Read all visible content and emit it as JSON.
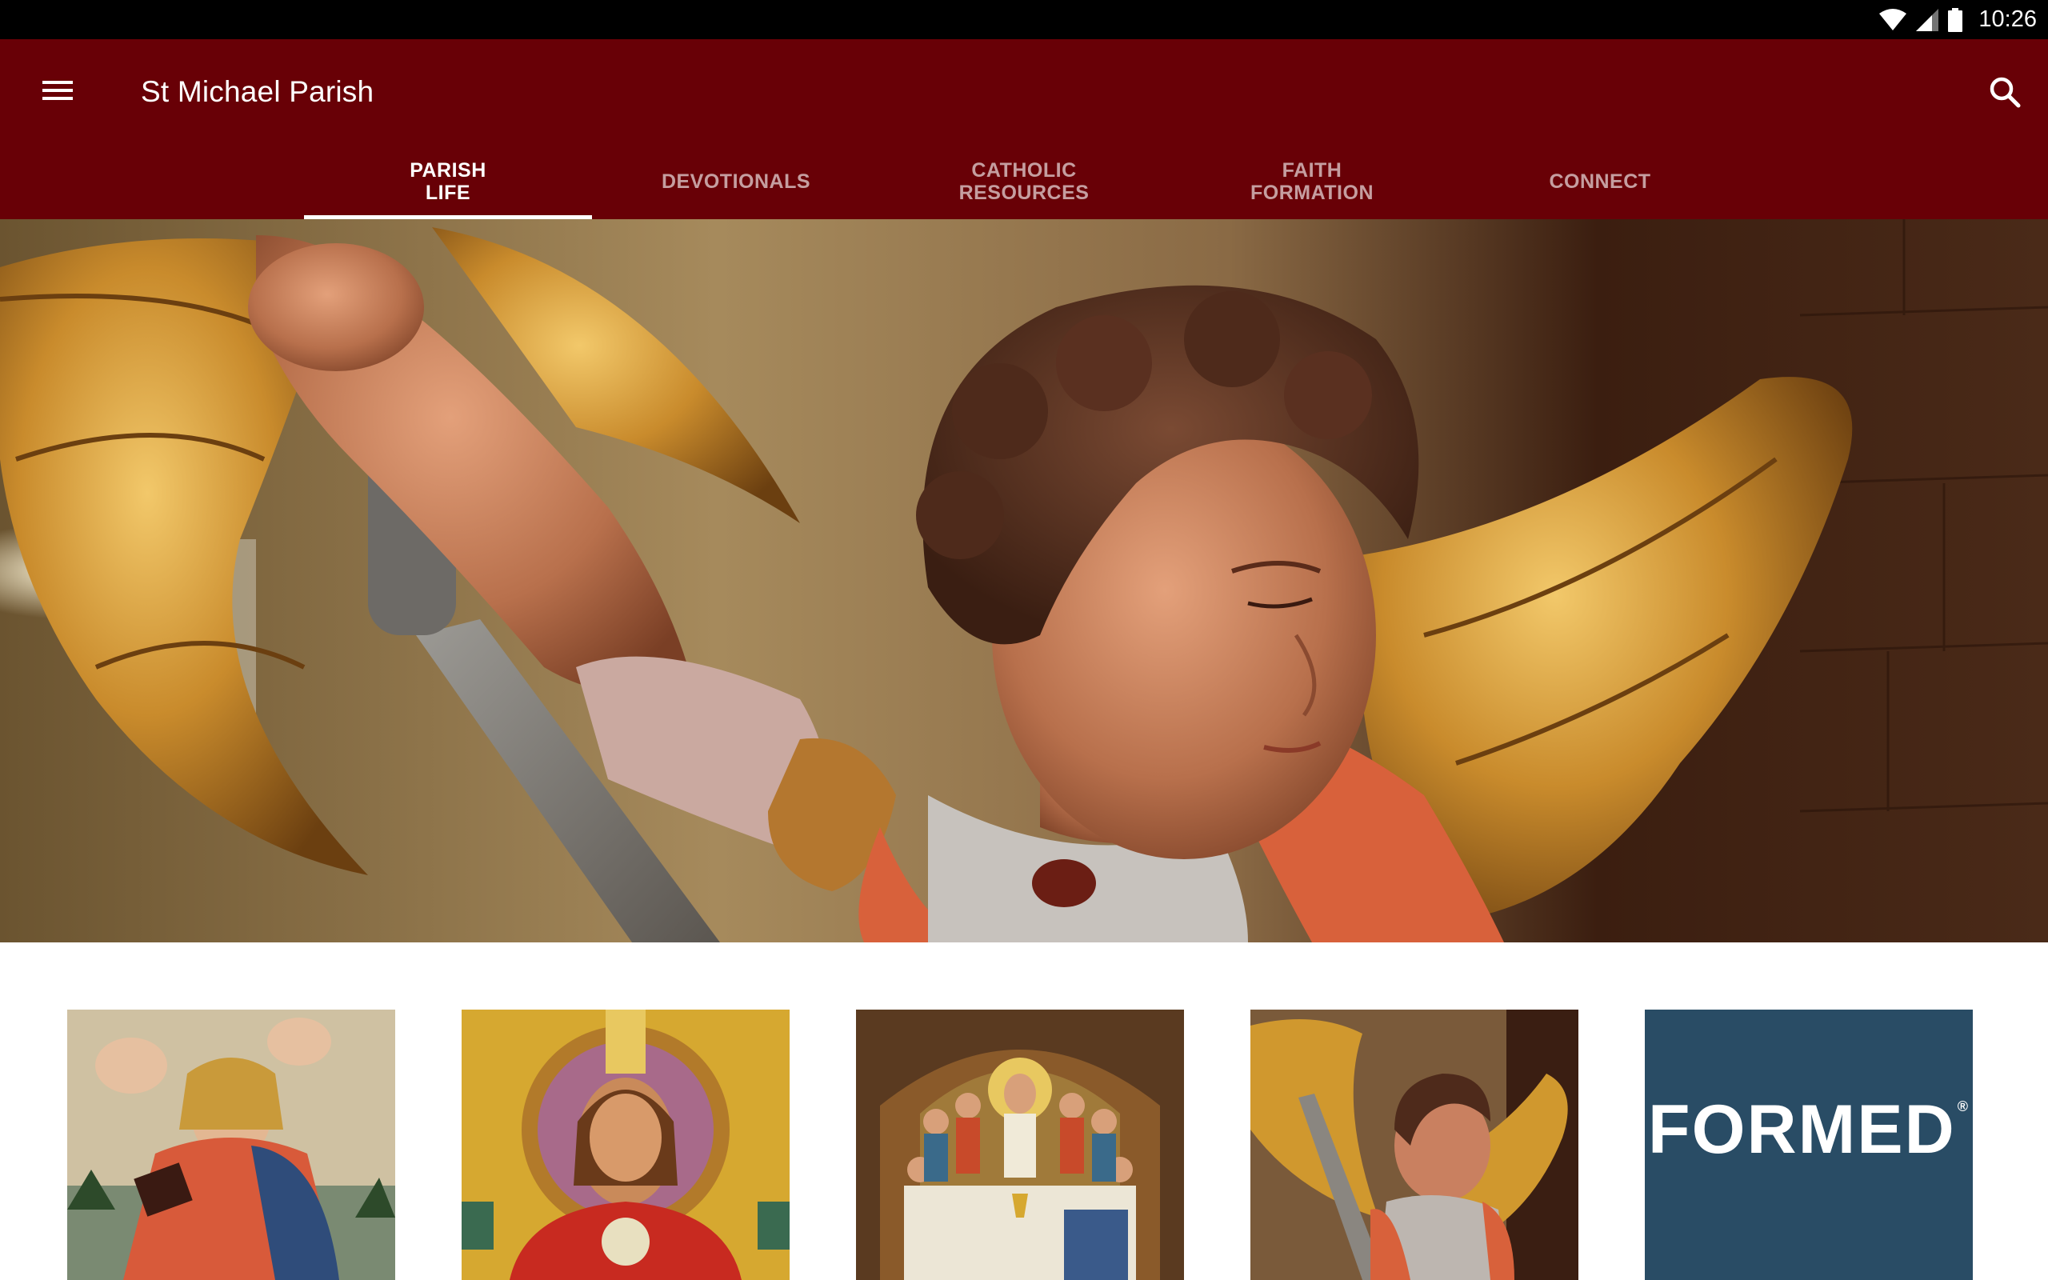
{
  "status_bar": {
    "time": "10:26",
    "icons": [
      "wifi-icon",
      "cell-signal-icon",
      "battery-icon"
    ]
  },
  "app_bar": {
    "title": "St Michael Parish",
    "menu_icon": "hamburger-menu-icon",
    "search_icon": "search-icon",
    "background_color": "#680006"
  },
  "tabs": [
    {
      "label": "PARISH\nLIFE",
      "active": true
    },
    {
      "label": "DEVOTIONALS",
      "active": false
    },
    {
      "label": "CATHOLIC\nRESOURCES",
      "active": false
    },
    {
      "label": "FAITH\nFORMATION",
      "active": false
    },
    {
      "label": "CONNECT",
      "active": false
    }
  ],
  "hero": {
    "image": "st-michael-archangel-statue"
  },
  "tiles": [
    {
      "image": "virgin-mary-painting"
    },
    {
      "image": "christ-mosaic"
    },
    {
      "image": "last-supper-mosaic"
    },
    {
      "image": "st-michael-statue"
    },
    {
      "logo_text": "FORMED",
      "logo_mark": "®",
      "background_color": "#294c65"
    }
  ]
}
